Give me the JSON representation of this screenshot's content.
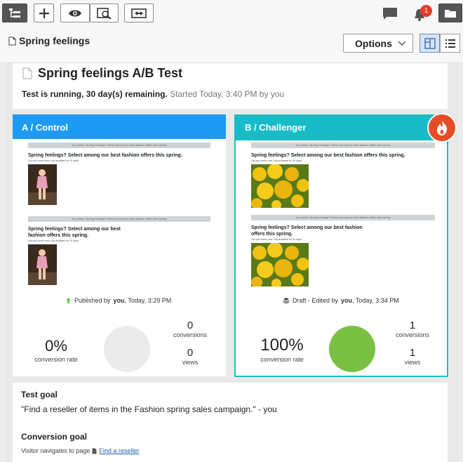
{
  "toolbar": {
    "notification_count": "1"
  },
  "breadcrumb": {
    "title": "Spring feelings"
  },
  "options": {
    "label": "Options"
  },
  "test": {
    "title": "Spring feelings A/B Test",
    "status_bold": "Test is running, 30 day(s) remaining.",
    "started": "Started Today, 3:40 PM by you"
  },
  "variant_a": {
    "header": "A / Control",
    "preview": {
      "top_bar": "You asked: Spring feelings? Select among our best fashion offers this spring.",
      "headline": "Spring feelings? Select among our best fashion offers this spring.",
      "sub": "Get your items now, only available for 30 days!",
      "bar2": "You asked: Spring feelings? Select among our best fashion offers this spring.",
      "headline2": "Spring feelings? Select among our best fashion offers this spring.",
      "sub2": "Get your items now, only available for 30 days!"
    },
    "published_prefix": "Published by",
    "published_user": "you",
    "published_time": ", Today, 3:29 PM",
    "conversion_rate": "0%",
    "conversion_rate_label": "conversion rate",
    "conversions": "0",
    "conversions_label": "conversions",
    "views": "0",
    "views_label": "views"
  },
  "variant_b": {
    "header": "B / Challenger",
    "preview": {
      "top_bar": "You asked: Spring feelings? Select among our best fashion offers this spring.",
      "headline": "Spring feelings? Select among our best fashion offers this spring.",
      "sub": "Get your items now, only available for 30 days!",
      "bar2": "You asked: Spring feelings? Select among our best fashion offers this spring.",
      "headline2": "Spring feelings? Select among our best fashion offers this spring.",
      "sub2": "Get your items now, only available for 30 days!"
    },
    "draft_prefix": "Draft - Edited by",
    "draft_user": "you",
    "draft_time": ", Today, 3:34 PM",
    "conversion_rate": "100%",
    "conversion_rate_label": "conversion rate",
    "conversions": "1",
    "conversions_label": "conversions",
    "views": "1",
    "views_label": "views"
  },
  "goals": {
    "test_goal_title": "Test goal",
    "test_goal_text": "\"Find a reseller of items in the Fashion spring sales campaign.\" - you",
    "conversion_goal_title": "Conversion goal",
    "conversion_goal_prefix": "Visitor navigates to page",
    "conversion_goal_link": "Find a reseller"
  },
  "colors": {
    "variant_a": "#1e9af4",
    "variant_b": "#19bcc6",
    "success_circle": "#7ac143",
    "empty_circle": "#ebebeb",
    "badge": "#e43b2a"
  }
}
